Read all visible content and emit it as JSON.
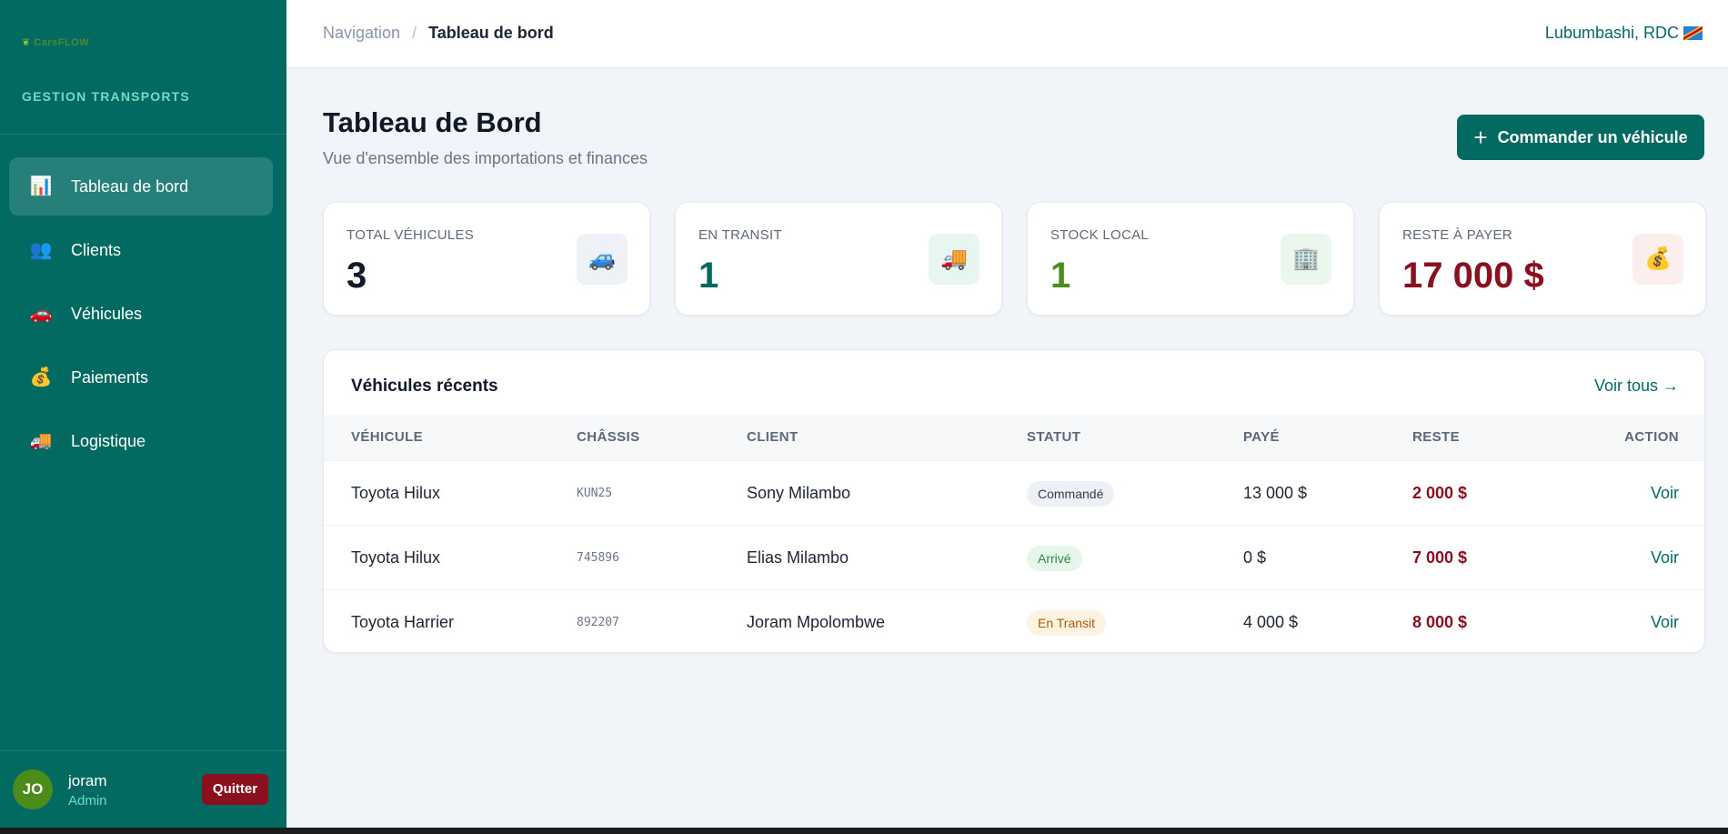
{
  "sidebar": {
    "logo_text": "CarsFLOW",
    "brand_title": "GESTION TRANSPORTS",
    "items": [
      {
        "label": "Tableau de bord",
        "icon": "📊"
      },
      {
        "label": "Clients",
        "icon": "👥"
      },
      {
        "label": "Véhicules",
        "icon": "🚗"
      },
      {
        "label": "Paiements",
        "icon": "💰"
      },
      {
        "label": "Logistique",
        "icon": "🚚"
      }
    ],
    "user": {
      "initials": "JO",
      "name": "joram",
      "role": "Admin",
      "logout_label": "Quitter"
    }
  },
  "topbar": {
    "breadcrumb_root": "Navigation",
    "breadcrumb_sep": "/",
    "breadcrumb_current": "Tableau de bord",
    "location": "Lubumbashi, RDC"
  },
  "page": {
    "title": "Tableau de Bord",
    "subtitle": "Vue d'ensemble des importations et finances",
    "primary_button": {
      "plus": "+",
      "label": "Commander un véhicule"
    }
  },
  "stats": [
    {
      "label": "TOTAL VÉHICULES",
      "value": "3",
      "icon": "🚙",
      "color": "#111827",
      "bg": "#eef1f6"
    },
    {
      "label": "EN TRANSIT",
      "value": "1",
      "icon": "🚚",
      "color": "#036a62",
      "bg": "#e8f6f1"
    },
    {
      "label": "STOCK LOCAL",
      "value": "1",
      "icon": "🏢",
      "color": "#4c8c1b",
      "bg": "#ebf7ec"
    },
    {
      "label": "RESTE À PAYER",
      "value": "17 000 $",
      "icon": "💰",
      "color": "#8a1020",
      "bg": "#fdeeee"
    }
  ],
  "recent": {
    "title": "Véhicules récents",
    "see_all": "Voir tous →",
    "headers": {
      "vehicle": "VÉHICULE",
      "chassis": "CHÂSSIS",
      "client": "CLIENT",
      "status": "STATUT",
      "paid": "PAYÉ",
      "rest": "RESTE",
      "action": "ACTION"
    },
    "rows": [
      {
        "vehicle": "Toyota Hilux",
        "chassis": "KUN25",
        "client": "Sony Milambo",
        "status": "Commandé",
        "paid": "13 000 $",
        "rest": "2 000 $",
        "action": "Voir"
      },
      {
        "vehicle": "Toyota Hilux",
        "chassis": "745896",
        "client": "Elias Milambo",
        "status": "Arrivé",
        "paid": "0 $",
        "rest": "7 000 $",
        "action": "Voir"
      },
      {
        "vehicle": "Toyota Harrier",
        "chassis": "892207",
        "client": "Joram Mpolombwe",
        "status": "En Transit",
        "paid": "4 000 $",
        "rest": "8 000 $",
        "action": "Voir"
      }
    ]
  }
}
